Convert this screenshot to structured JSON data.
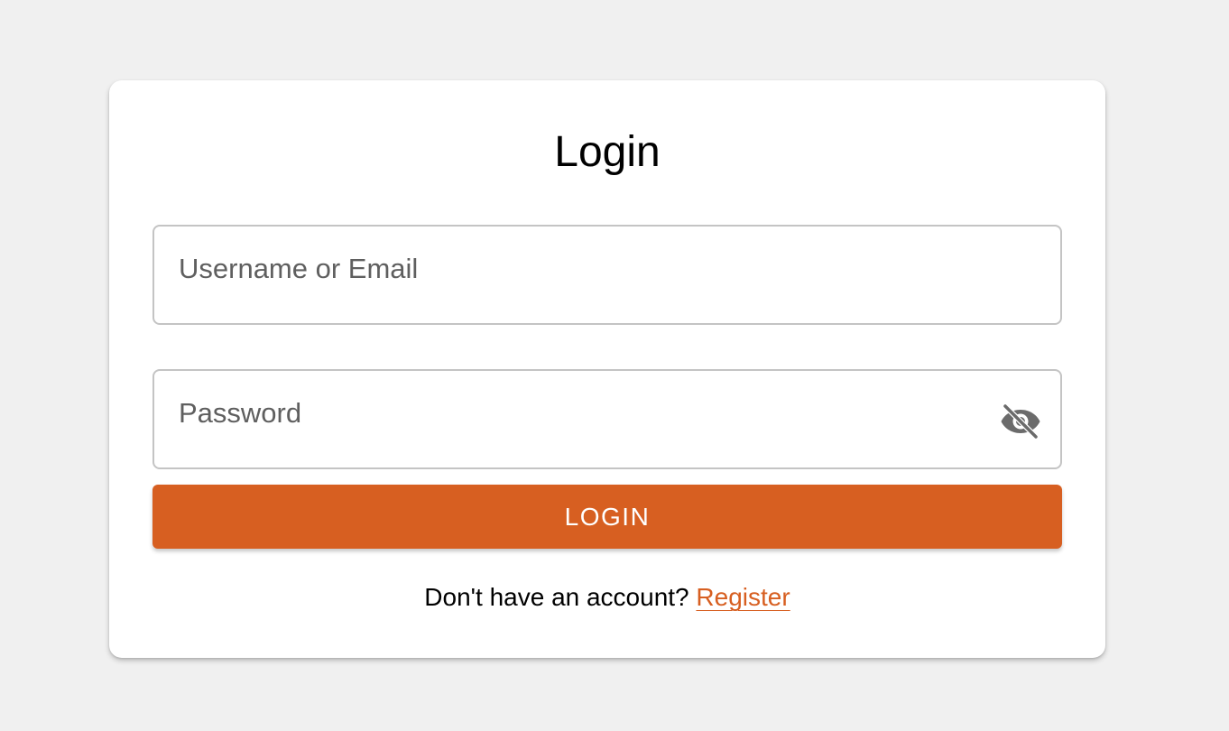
{
  "colors": {
    "background": "#f0f0f0",
    "card": "#ffffff",
    "accent": "#d75f21",
    "border": "#c4c4c4",
    "placeholder": "#5f5f5f"
  },
  "login_form": {
    "title": "Login",
    "username": {
      "value": "",
      "placeholder": "Username or Email"
    },
    "password": {
      "value": "",
      "placeholder": "Password",
      "visibility_icon": "eye-off-icon"
    },
    "submit_label": "LOGIN",
    "register_prompt": "Don't have an account?",
    "register_link": "Register"
  }
}
